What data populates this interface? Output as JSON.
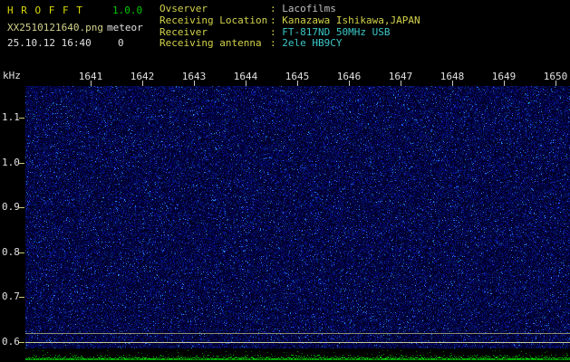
{
  "app": {
    "title": "H R O F F T",
    "version": "1.0.0",
    "filename": "XX2510121640.png",
    "mode": "meteor",
    "datetime": "25.10.12 16:40",
    "count": "0"
  },
  "station_info": {
    "label_color": "#d2d24a",
    "rows": [
      {
        "label": "Ovserver",
        "value": "Lacofilms",
        "value_color": "#c0c0c0"
      },
      {
        "label": "Receiving Location",
        "value": "Kanazawa Ishikawa,JAPAN",
        "value_color": "#d2d24a"
      },
      {
        "label": "Receiver",
        "value": "FT-817ND 50MHz USB",
        "value_color": "#3cc8c8"
      },
      {
        "label": "Receiving antenna",
        "value": "2ele HB9CY",
        "value_color": "#3cc8c8"
      }
    ]
  },
  "chart_data": {
    "type": "heatmap",
    "title": "HROFFT radio meteor echo spectrogram",
    "ylabel": "kHz",
    "x_ticks": [
      "1641",
      "1642",
      "1643",
      "1644",
      "1645",
      "1646",
      "1647",
      "1648",
      "1649",
      "1650"
    ],
    "x_axis_meaning": "time hhmm (16:41 - 16:50)",
    "y_ticks": [
      "1.1",
      "1.0",
      "0.9",
      "0.8",
      "0.7",
      "0.6"
    ],
    "y_range_khz": [
      0.58,
      1.17
    ],
    "marker_lines_khz": [
      0.62,
      0.6
    ],
    "marker_line_colors": [
      "#8c8c6e",
      "#c8c89a"
    ],
    "noise_base_color": "#000a3c",
    "sparkle_color": "#3c78ff",
    "level_strip_color": "#00c800",
    "grid": false,
    "legend": false
  },
  "colors": {
    "background": "#000000",
    "title": "#d9d900",
    "version": "#00c800",
    "filename": "#d2d28c",
    "axis_text": "#e0e0e0",
    "tick": "#c8c87a"
  }
}
